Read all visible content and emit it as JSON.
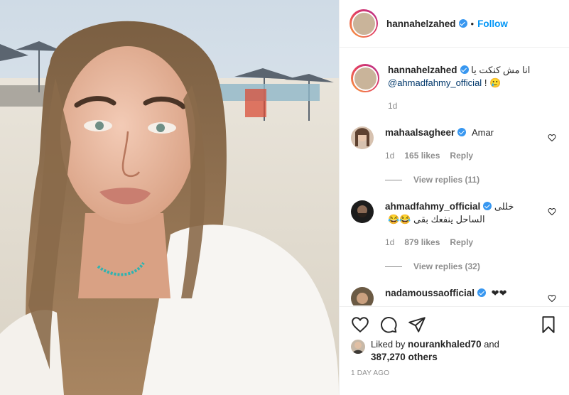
{
  "header": {
    "username": "hannahelzahed",
    "separator": "•",
    "follow_label": "Follow"
  },
  "caption": {
    "username": "hannahelzahed",
    "text": "انا مش كنكت يا",
    "mention": "@ahmadfahmy_official",
    "text_end": " ! 🥲",
    "time": "1d"
  },
  "comments": [
    {
      "username": "mahaalsagheer",
      "text": "Amar",
      "time": "1d",
      "likes": "165 likes",
      "reply": "Reply",
      "view_replies": "View replies (11)"
    },
    {
      "username": "ahmadfahmy_official",
      "text": "خللى الساحل ينفعك بقى 😂😂",
      "time": "1d",
      "likes": "879 likes",
      "reply": "Reply",
      "view_replies": "View replies (32)"
    },
    {
      "username": "nadamoussaofficial",
      "text": "❤❤"
    }
  ],
  "likes": {
    "prefix": "Liked by ",
    "user": "nourankhaled70",
    "middle": " and",
    "count": "387,270 others"
  },
  "timestamp": "1 DAY AGO",
  "colors": {
    "accent": "#0095f6",
    "verified": "#3897f0",
    "muted": "#8e8e8e"
  },
  "icons": [
    "heart-icon",
    "comment-icon",
    "share-icon",
    "bookmark-icon",
    "verified-badge-icon"
  ]
}
